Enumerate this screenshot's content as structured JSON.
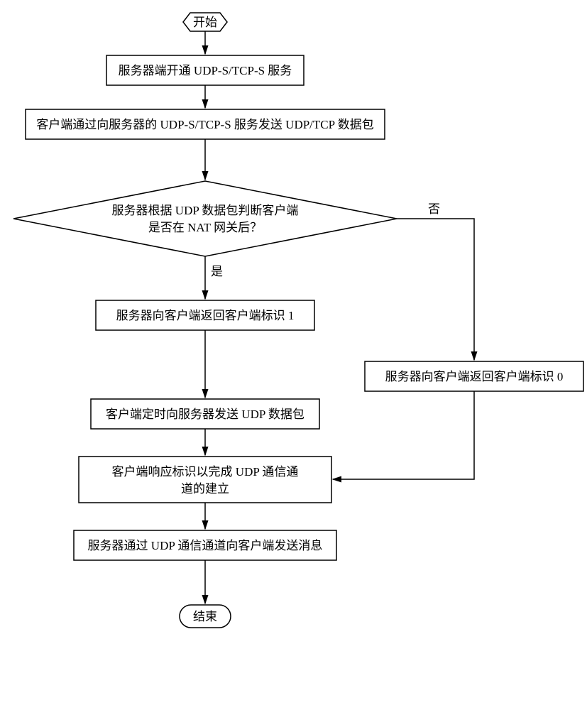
{
  "chart_data": {
    "type": "flowchart",
    "nodes": {
      "start": {
        "label": "开始",
        "shape": "terminator"
      },
      "step1": {
        "label": "服务器端开通 UDP-S/TCP-S 服务",
        "shape": "process"
      },
      "step2": {
        "label": "客户端通过向服务器的 UDP-S/TCP-S 服务发送 UDP/TCP 数据包",
        "shape": "process"
      },
      "decision": {
        "line1": "服务器根据 UDP 数据包判断客户端",
        "line2": "是否在 NAT 网关后？",
        "shape": "decision"
      },
      "yes_branch": {
        "label": "服务器向客户端返回客户端标识 1",
        "shape": "process"
      },
      "no_branch": {
        "label": "服务器向客户端返回客户端标识 0",
        "shape": "process"
      },
      "step5": {
        "label": "客户端定时向服务器发送 UDP 数据包",
        "shape": "process"
      },
      "step6": {
        "line1": "客户端响应标识以完成 UDP 通信通",
        "line2": "道的建立",
        "shape": "process"
      },
      "step7": {
        "label": "服务器通过 UDP 通信通道向客户端发送消息",
        "shape": "process"
      },
      "end": {
        "label": "结束",
        "shape": "terminator"
      }
    },
    "edges": {
      "yes": "是",
      "no": "否"
    }
  }
}
